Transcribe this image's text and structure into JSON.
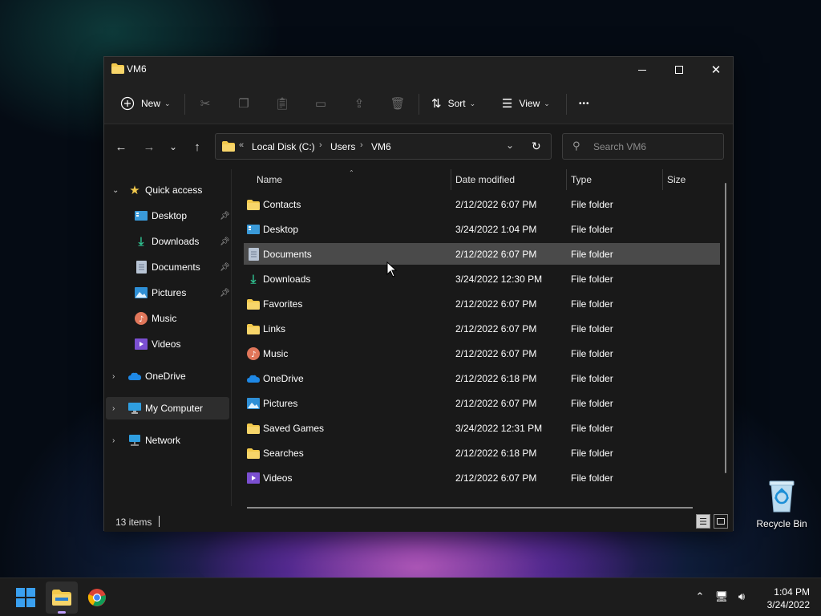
{
  "window": {
    "title": "VM6",
    "controls": {
      "minimize": "—",
      "maximize": "☐",
      "close": "✕"
    }
  },
  "toolbar": {
    "new_label": "New",
    "sort_label": "Sort",
    "view_label": "View",
    "more_label": "•••",
    "icons": [
      "cut-icon",
      "copy-icon",
      "paste-icon",
      "rename-icon",
      "share-icon",
      "delete-icon"
    ]
  },
  "navigation": {
    "back": "←",
    "forward": "→",
    "recent": "⌄",
    "up": "↑",
    "address": {
      "overflow": "«",
      "crumbs": [
        "Local Disk (C:)",
        "Users",
        "VM6"
      ],
      "separator": "›"
    },
    "search": {
      "placeholder": "Search VM6"
    }
  },
  "sidebar": {
    "quick_access": "Quick access",
    "items": [
      {
        "label": "Desktop",
        "pinned": true,
        "icon": "desktop-icon"
      },
      {
        "label": "Downloads",
        "pinned": true,
        "icon": "downloads-icon"
      },
      {
        "label": "Documents",
        "pinned": true,
        "icon": "documents-icon"
      },
      {
        "label": "Pictures",
        "pinned": true,
        "icon": "pictures-icon"
      },
      {
        "label": "Music",
        "pinned": false,
        "icon": "music-icon"
      },
      {
        "label": "Videos",
        "pinned": false,
        "icon": "videos-icon"
      }
    ],
    "onedrive": "OneDrive",
    "my_computer": "My Computer",
    "network": "Network"
  },
  "file_list": {
    "columns": {
      "name": "Name",
      "date": "Date modified",
      "type": "Type",
      "size": "Size"
    },
    "rows": [
      {
        "name": "Contacts",
        "date": "2/12/2022 6:07 PM",
        "type": "File folder",
        "icon": "folder-icon"
      },
      {
        "name": "Desktop",
        "date": "3/24/2022 1:04 PM",
        "type": "File folder",
        "icon": "desktop-icon"
      },
      {
        "name": "Documents",
        "date": "2/12/2022 6:07 PM",
        "type": "File folder",
        "icon": "documents-icon"
      },
      {
        "name": "Downloads",
        "date": "3/24/2022 12:30 PM",
        "type": "File folder",
        "icon": "downloads-icon"
      },
      {
        "name": "Favorites",
        "date": "2/12/2022 6:07 PM",
        "type": "File folder",
        "icon": "folder-icon"
      },
      {
        "name": "Links",
        "date": "2/12/2022 6:07 PM",
        "type": "File folder",
        "icon": "folder-icon"
      },
      {
        "name": "Music",
        "date": "2/12/2022 6:07 PM",
        "type": "File folder",
        "icon": "music-icon"
      },
      {
        "name": "OneDrive",
        "date": "2/12/2022 6:18 PM",
        "type": "File folder",
        "icon": "onedrive-icon"
      },
      {
        "name": "Pictures",
        "date": "2/12/2022 6:07 PM",
        "type": "File folder",
        "icon": "pictures-icon"
      },
      {
        "name": "Saved Games",
        "date": "3/24/2022 12:31 PM",
        "type": "File folder",
        "icon": "folder-icon"
      },
      {
        "name": "Searches",
        "date": "2/12/2022 6:18 PM",
        "type": "File folder",
        "icon": "folder-icon"
      },
      {
        "name": "Videos",
        "date": "2/12/2022 6:07 PM",
        "type": "File folder",
        "icon": "videos-icon"
      }
    ],
    "selected_row": "Documents"
  },
  "status": {
    "item_count": "13 items"
  },
  "desktop": {
    "recycle_bin": "Recycle Bin"
  },
  "taskbar": {
    "apps": [
      "start-icon",
      "file-explorer-icon",
      "chrome-icon"
    ],
    "clock": {
      "time": "1:04 PM",
      "date": "3/24/2022"
    }
  },
  "colors": {
    "folder": "#f2c94c",
    "accent": "#0078d4",
    "selection": "#4a4a4a"
  }
}
